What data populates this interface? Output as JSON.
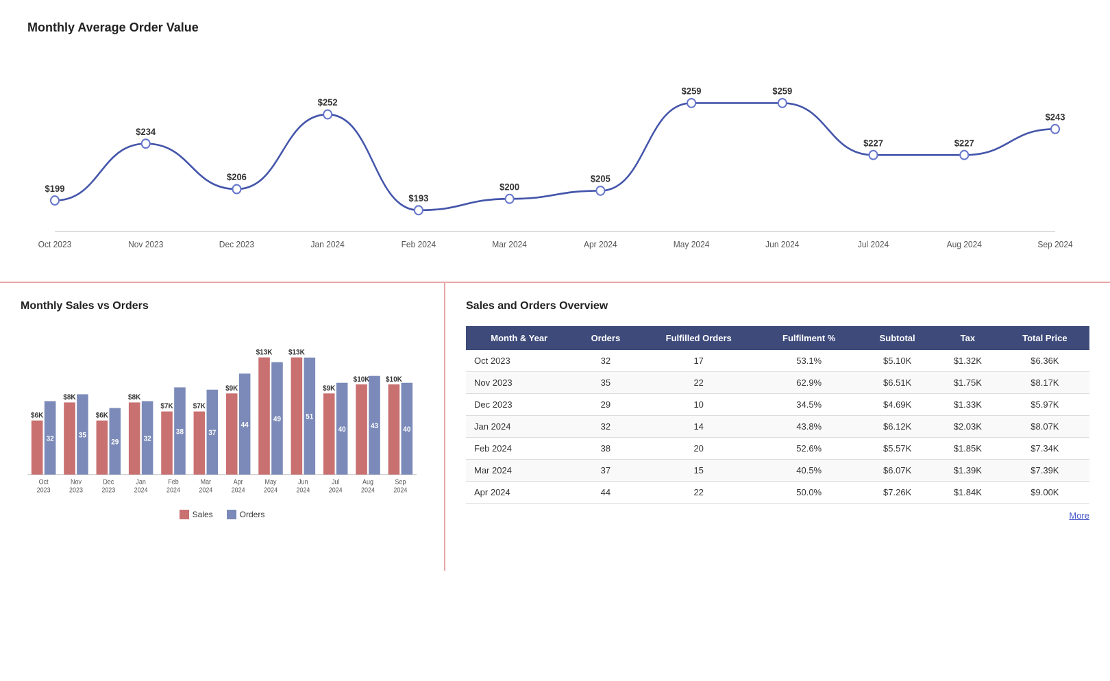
{
  "topChart": {
    "title": "Monthly Average Order Value",
    "months": [
      "Oct 2023",
      "Nov 2023",
      "Dec 2023",
      "Jan 2024",
      "Feb 2024",
      "Mar 2024",
      "Apr 2024",
      "May 2024",
      "Jun 2024",
      "Jul 2024",
      "Aug 2024",
      "Sep 2024"
    ],
    "values": [
      199,
      234,
      206,
      252,
      193,
      200,
      205,
      259,
      259,
      227,
      227,
      243
    ],
    "labels": [
      "$199",
      "$234",
      "$206",
      "$252",
      "$193",
      "$200",
      "$205",
      "$259",
      "$259",
      "$227",
      "$227",
      "$243"
    ],
    "lineColor": "#4455aa",
    "dotColor": "#ffffff",
    "dotStroke": "#6677cc"
  },
  "barChart": {
    "title": "Monthly Sales vs Orders",
    "months": [
      "Oct 2023",
      "Nov 2023",
      "Dec 2023",
      "Jan 2024",
      "Feb 2024",
      "Mar 2024",
      "Apr 2024",
      "May 2024",
      "Jun 2024",
      "Jul 2024",
      "Aug 2024",
      "Sep 2024"
    ],
    "salesValues": [
      6,
      8,
      6,
      8,
      7,
      7,
      9,
      13,
      13,
      9,
      10,
      10
    ],
    "salesLabels": [
      "$6K",
      "$8K",
      "$6K",
      "$8K",
      "$7K",
      "$7K",
      "$9K",
      "$13K",
      "$13K",
      "$9K",
      "$10K",
      "$10K"
    ],
    "ordersValues": [
      32,
      35,
      29,
      32,
      38,
      37,
      44,
      49,
      51,
      40,
      43,
      40
    ],
    "salesColor": "#c97070",
    "ordersColor": "#7b8ab8",
    "legend": {
      "sales": "Sales",
      "orders": "Orders"
    }
  },
  "table": {
    "title": "Sales and Orders Overview",
    "headers": [
      "Month & Year",
      "Orders",
      "Fulfilled Orders",
      "Fulfilment %",
      "Subtotal",
      "Tax",
      "Total Price"
    ],
    "rows": [
      [
        "Oct 2023",
        "32",
        "17",
        "53.1%",
        "$5.10K",
        "$1.32K",
        "$6.36K"
      ],
      [
        "Nov 2023",
        "35",
        "22",
        "62.9%",
        "$6.51K",
        "$1.75K",
        "$8.17K"
      ],
      [
        "Dec 2023",
        "29",
        "10",
        "34.5%",
        "$4.69K",
        "$1.33K",
        "$5.97K"
      ],
      [
        "Jan 2024",
        "32",
        "14",
        "43.8%",
        "$6.12K",
        "$2.03K",
        "$8.07K"
      ],
      [
        "Feb 2024",
        "38",
        "20",
        "52.6%",
        "$5.57K",
        "$1.85K",
        "$7.34K"
      ],
      [
        "Mar 2024",
        "37",
        "15",
        "40.5%",
        "$6.07K",
        "$1.39K",
        "$7.39K"
      ],
      [
        "Apr 2024",
        "44",
        "22",
        "50.0%",
        "$7.26K",
        "$1.84K",
        "$9.00K"
      ]
    ]
  },
  "footer": {
    "moreLabel": "More"
  }
}
